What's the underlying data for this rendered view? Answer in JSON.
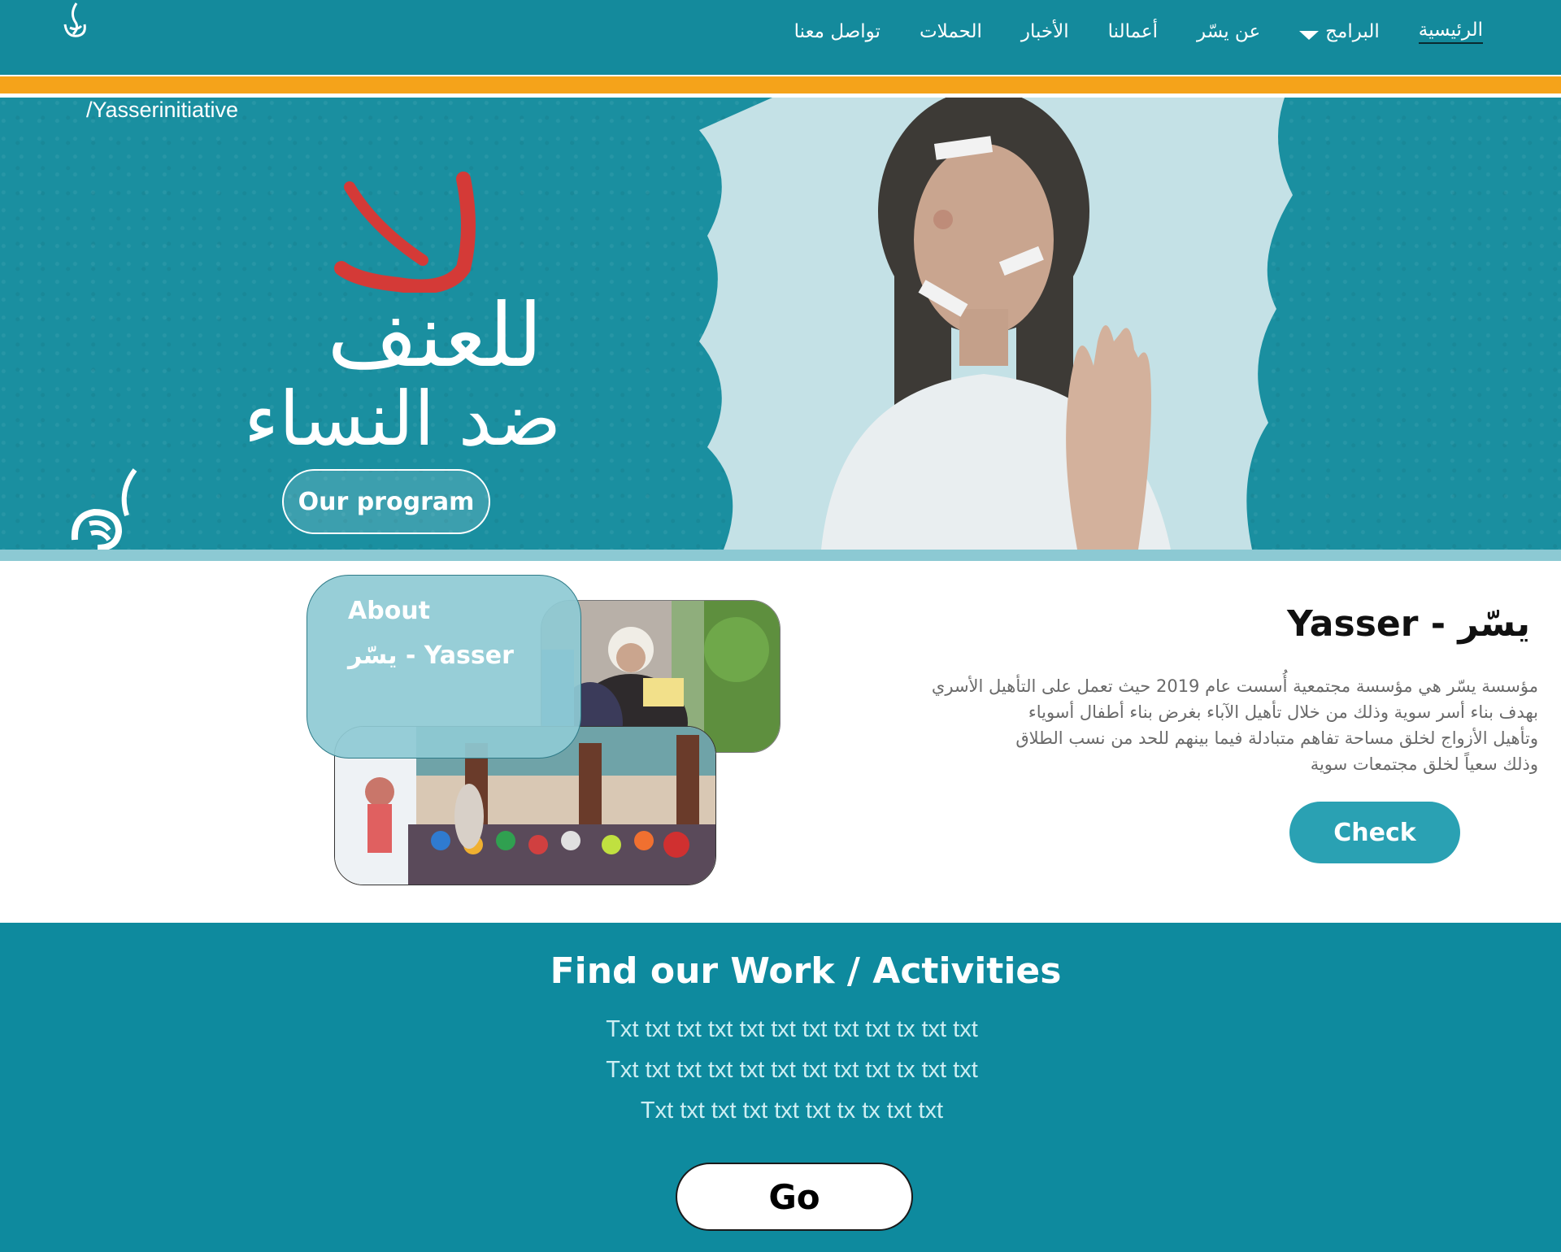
{
  "nav": {
    "logo_icon": "yasser-logo-icon",
    "items": [
      {
        "label": "الرئيسية",
        "active": true
      },
      {
        "label": "البرامج",
        "dropdown": true
      },
      {
        "label": "عن يسّر"
      },
      {
        "label": "أعمالنا"
      },
      {
        "label": "الأخبار"
      },
      {
        "label": "الحملات"
      },
      {
        "label": "تواصل معنا"
      }
    ]
  },
  "hero": {
    "handle": "/Yasserinitiative",
    "title_line_1": "للعنف",
    "title_line_2": "ضد النساء",
    "program_button": "Our program"
  },
  "about": {
    "card_title": "About",
    "card_subtitle": "يسّر - Yasser",
    "heading": "Yasser - يسّر",
    "paragraph_lines": [
      "مؤسسة يسّر هي مؤسسة مجتمعية أُسست عام 2019 حيث تعمل على التأهيل الأسري",
      "بهدف بناء أسر سوية وذلك من خلال تأهيل الآباء بغرض بناء أطفال أسوياء",
      "وتأهيل الأزواج لخلق مساحة تفاهم متبادلة فيما بينهم للحد من نسب الطلاق",
      "وذلك سعياً لخلق مجتمعات سوية"
    ],
    "check_button": "Check"
  },
  "work": {
    "title": "Find our Work / Activities",
    "lines": [
      "Txt txt txt txt txt txt txt txt txt tx txt txt",
      "Txt txt txt txt txt txt txt txt txt tx txt txt",
      "Txt txt txt txt txt txt tx tx txt txt"
    ],
    "go_button": "Go"
  },
  "colors": {
    "primary_teal": "#148a9c",
    "accent_orange": "#f5a31a",
    "hero_red": "#d43a37",
    "card_teal_light": "#8ecad4",
    "button_teal": "#2aa1b3"
  }
}
